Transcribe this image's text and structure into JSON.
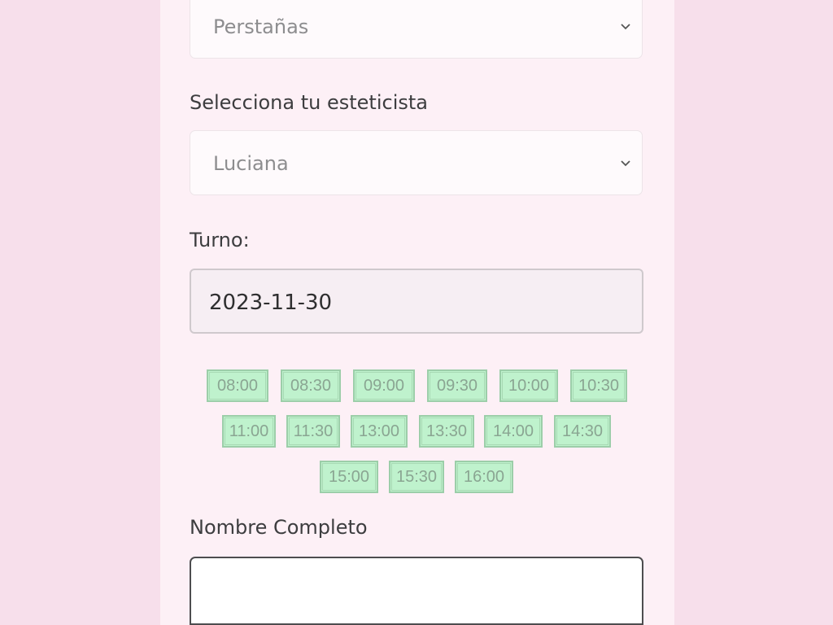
{
  "service_select": {
    "value": "Perstañas",
    "icon": "chevron-down-icon"
  },
  "esthetician": {
    "label": "Selecciona tu esteticista",
    "value": "Luciana",
    "icon": "chevron-down-icon"
  },
  "turno": {
    "label": "Turno:",
    "date": "2023-11-30"
  },
  "time_slots": [
    [
      "08:00",
      "08:30",
      "09:00",
      "09:30",
      "10:00",
      "10:30"
    ],
    [
      "11:00",
      "11:30",
      "13:00",
      "13:30",
      "14:00",
      "14:30"
    ],
    [
      "15:00",
      "15:30",
      "16:00"
    ]
  ],
  "full_name": {
    "label": "Nombre Completo",
    "value": ""
  },
  "colors": {
    "page_bg": "#f7dfeb",
    "panel_bg": "#fdf0f6",
    "slot_bg": "#bff2cd",
    "slot_text": "#8aa592"
  }
}
